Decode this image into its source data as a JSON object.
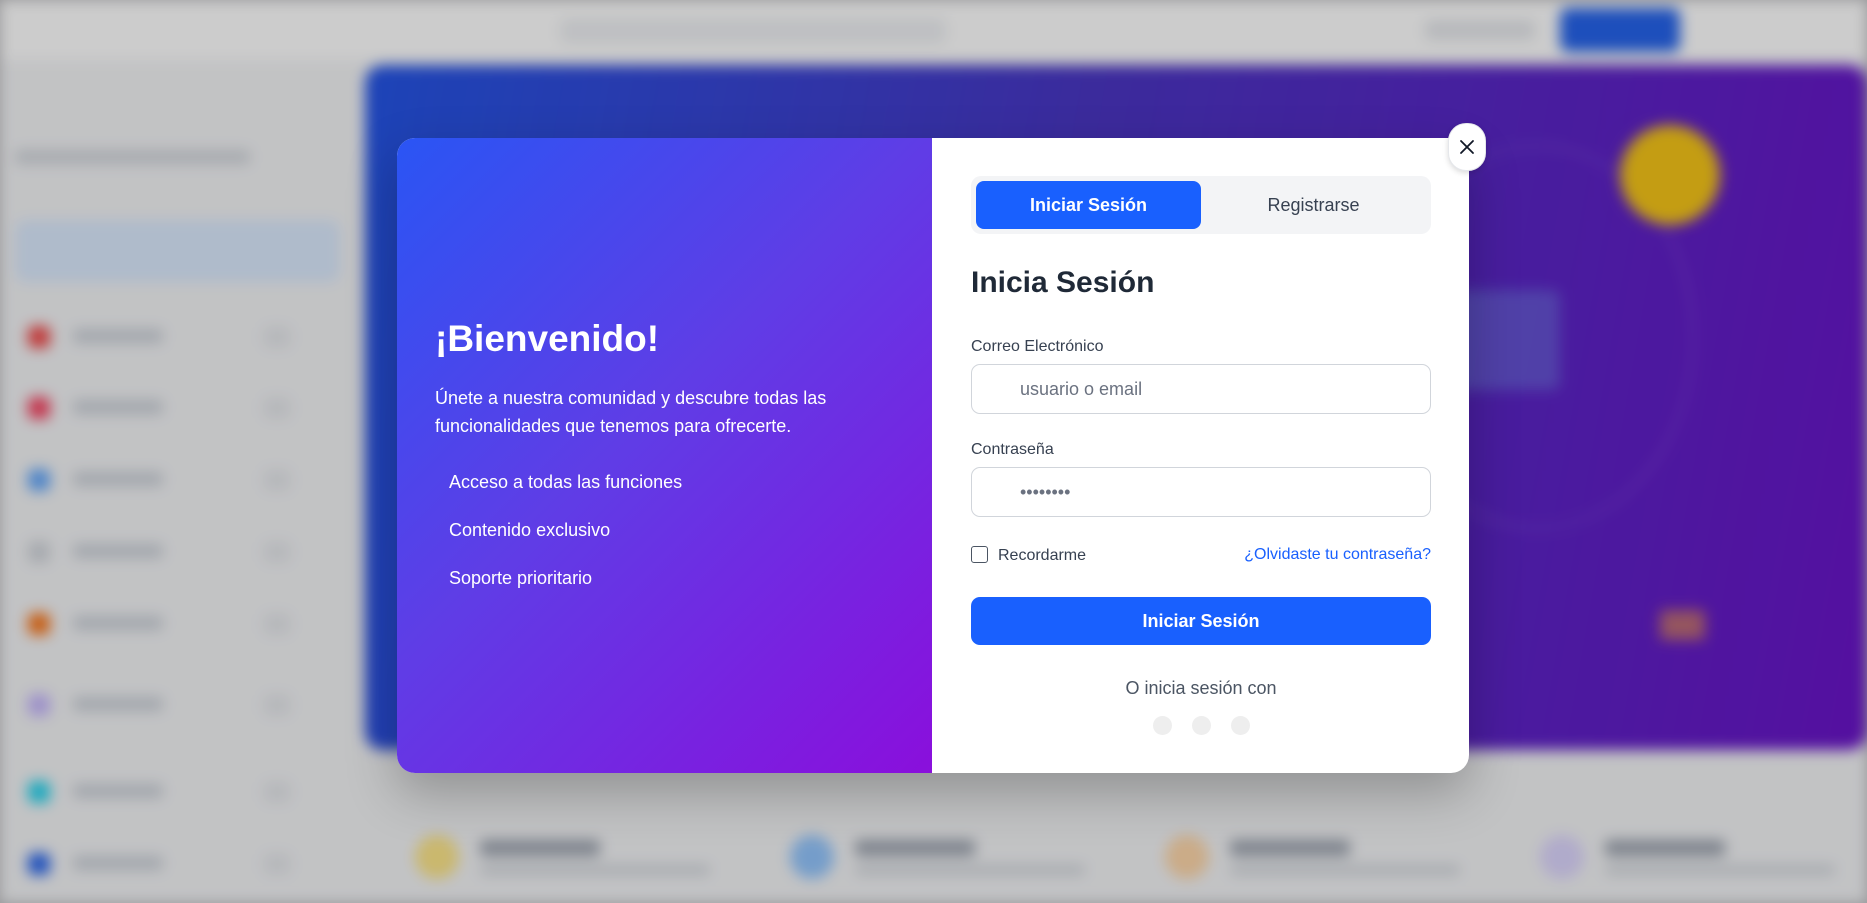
{
  "modal": {
    "welcome": {
      "title": "¡Bienvenido!",
      "description": "Únete a nuestra comunidad y descubre todas las funcionalidades que tenemos para ofrecerte.",
      "features": [
        "Acceso a todas las funciones",
        "Contenido exclusivo",
        "Soporte prioritario"
      ]
    },
    "tabs": {
      "login": "Iniciar Sesión",
      "register": "Registrarse"
    },
    "form": {
      "title": "Inicia Sesión",
      "email_label": "Correo Electrónico",
      "email_placeholder": "usuario o email",
      "password_label": "Contraseña",
      "password_value": "••••••••",
      "remember_label": "Recordarme",
      "forgot_link": "¿Olvidaste tu contraseña?",
      "submit_label": "Iniciar Sesión",
      "alt_text": "O inicia sesión con"
    },
    "socials": [
      "social-icon-1",
      "social-icon-2",
      "social-icon-3"
    ]
  },
  "colors": {
    "primary": "#1960fe",
    "gradient_start": "#2a55f4",
    "gradient_end": "#8a0fdc"
  }
}
